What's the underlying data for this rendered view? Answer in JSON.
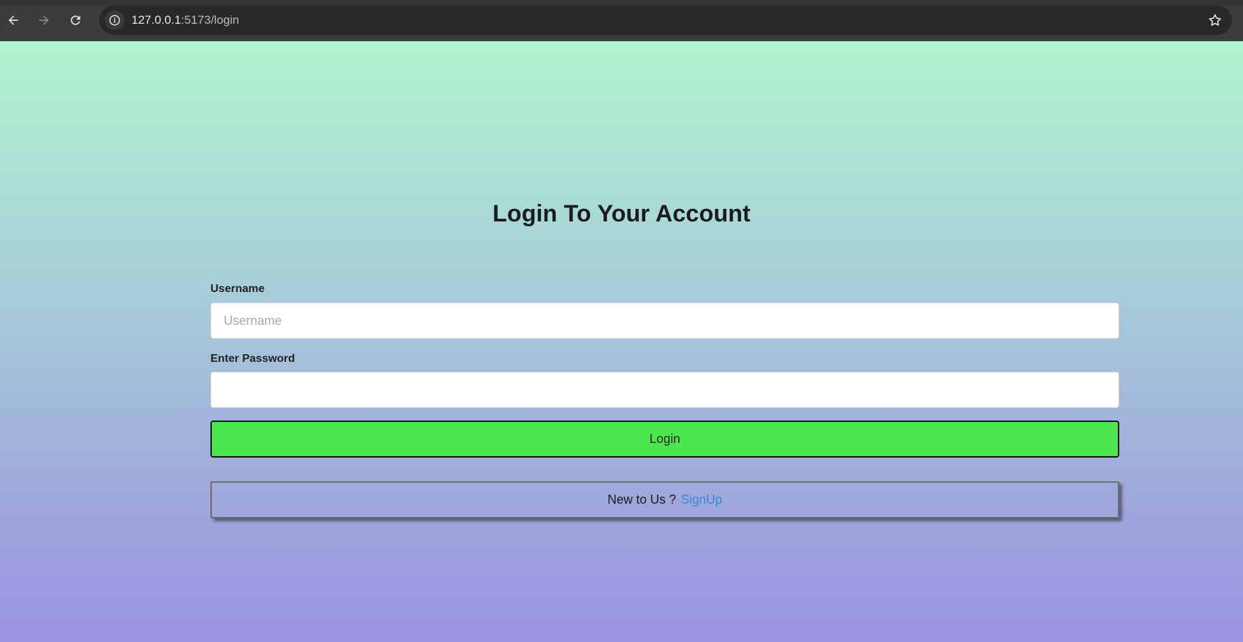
{
  "browser": {
    "url_host": "127.0.0.1",
    "url_path": ":5173/login"
  },
  "login_page": {
    "title": "Login To Your Account",
    "username_label": "Username",
    "username_placeholder": "Username",
    "password_label": "Enter Password",
    "login_button_label": "Login",
    "signup_prompt": "New to Us ?",
    "signup_link_label": "SignUp"
  },
  "colors": {
    "login_button": "#4ce650",
    "signup_link": "#3a86d6",
    "gradient_top": "#b1f5cf",
    "gradient_bottom": "#9b93e2"
  }
}
